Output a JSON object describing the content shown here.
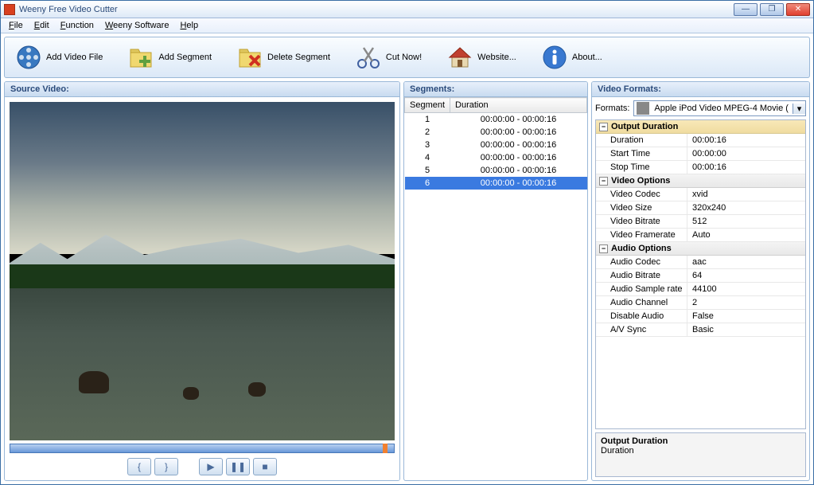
{
  "window": {
    "title": "Weeny Free Video Cutter"
  },
  "menu": {
    "file": "File",
    "edit": "Edit",
    "func": "Function",
    "ws": "Weeny Software",
    "help": "Help"
  },
  "toolbar": {
    "addfile": "Add Video File",
    "addseg": "Add Segment",
    "delseg": "Delete Segment",
    "cut": "Cut Now!",
    "website": "Website...",
    "about": "About..."
  },
  "panels": {
    "source": "Source Video:",
    "segments": "Segments:",
    "formats": "Video Formats:"
  },
  "segments": {
    "col_seg": "Segment",
    "col_dur": "Duration",
    "rows": [
      {
        "n": "1",
        "d": "00:00:00 - 00:00:16"
      },
      {
        "n": "2",
        "d": "00:00:00 - 00:00:16"
      },
      {
        "n": "3",
        "d": "00:00:00 - 00:00:16"
      },
      {
        "n": "4",
        "d": "00:00:00 - 00:00:16"
      },
      {
        "n": "5",
        "d": "00:00:00 - 00:00:16"
      },
      {
        "n": "6",
        "d": "00:00:00 - 00:00:16"
      }
    ],
    "selected": 5
  },
  "formats": {
    "label": "Formats:",
    "selected": "Apple iPod Video MPEG-4 Movie (",
    "cats": {
      "output": "Output Duration",
      "video": "Video Options",
      "audio": "Audio Options"
    },
    "props": {
      "duration_k": "Duration",
      "duration_v": "00:00:16",
      "start_k": "Start Time",
      "start_v": "00:00:00",
      "stop_k": "Stop Time",
      "stop_v": "00:00:16",
      "vcodec_k": "Video Codec",
      "vcodec_v": "xvid",
      "vsize_k": "Video Size",
      "vsize_v": "320x240",
      "vbitrate_k": "Video Bitrate",
      "vbitrate_v": "512",
      "vfps_k": "Video Framerate",
      "vfps_v": "Auto",
      "acodec_k": "Audio Codec",
      "acodec_v": "aac",
      "abitrate_k": "Audio Bitrate",
      "abitrate_v": "64",
      "asample_k": "Audio Sample rate",
      "asample_v": "44100",
      "achan_k": "Audio Channel",
      "achan_v": "2",
      "adisable_k": "Disable Audio",
      "adisable_v": "False",
      "avsync_k": "A/V Sync",
      "avsync_v": "Basic"
    },
    "desc_h": "Output Duration",
    "desc_t": "Duration"
  }
}
